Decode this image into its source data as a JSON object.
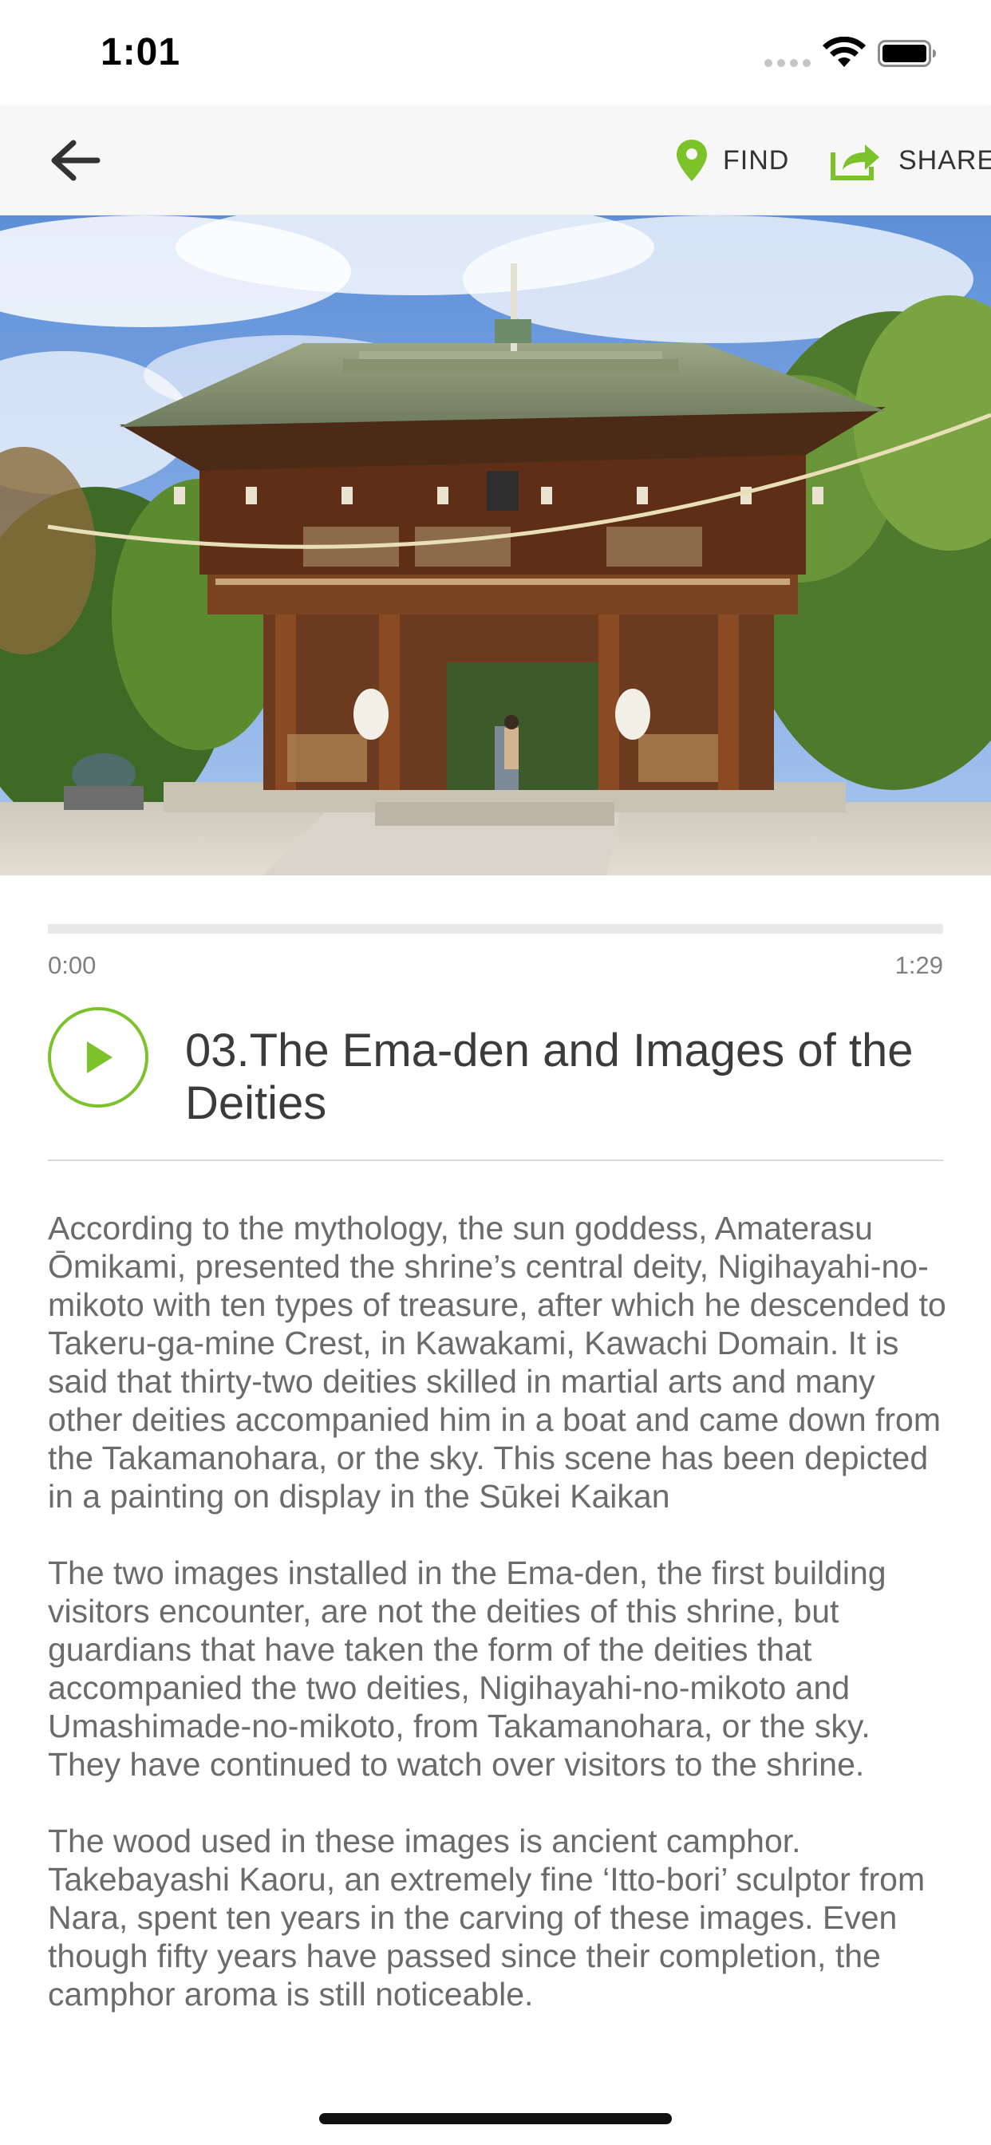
{
  "status_bar": {
    "time": "1:01"
  },
  "nav": {
    "back_icon": "arrow-left-icon",
    "find_label": "FIND",
    "find_icon": "map-pin-icon",
    "share_label": "SHARE",
    "share_icon": "share-box-icon",
    "accent_color": "#7cc22a"
  },
  "hero": {
    "image_subject": "wooden shrine gate under blue sky with trees"
  },
  "player": {
    "current_time": "0:00",
    "duration": "1:29",
    "progress": 0,
    "play_icon": "play-icon",
    "title": "03.The Ema-den and Images of the Deities"
  },
  "description": {
    "paragraphs": [
      "According to the mythology, the sun goddess, Amaterasu Ōmikami, presented the shrine’s central deity, Nigihayahi-no-mikoto with ten types of treasure, after which he descended to Takeru-ga-mine Crest, in Kawakami, Kawachi Domain. It is said that thirty-two deities skilled in martial arts and many other deities accompanied him in a boat and came down from the Takamanohara, or the sky. This scene has been depicted in a painting on display in the Sūkei Kaikan",
      "The two images installed in the Ema-den, the first building visitors encounter, are not the deities of this shrine, but guardians that have taken the form of the deities that accompanied the two deities, Nigihayahi-no-mikoto and Umashimade-no-mikoto, from Takamanohara, or the sky. They have continued to watch over visitors to the shrine.",
      "The wood used in these images is ancient camphor. Takebayashi Kaoru, an extremely fine ‘Itto-bori’ sculptor from Nara, spent ten years in the carving of these images. Even though fifty years have passed since their completion, the camphor aroma is still noticeable."
    ]
  }
}
